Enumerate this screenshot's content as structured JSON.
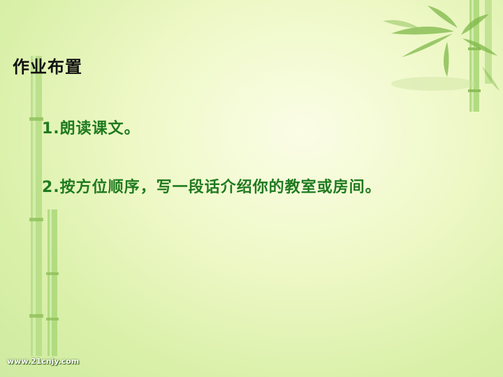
{
  "slide": {
    "title": "作业布置",
    "items": [
      "1.朗读课文。",
      "2.按方位顺序，写一段话介绍你的教室或房间。"
    ],
    "watermark": "www.21cnjy.com"
  },
  "colors": {
    "title": "#111111",
    "items": "#1f7a1f",
    "bamboo": "#9ccc5a"
  }
}
